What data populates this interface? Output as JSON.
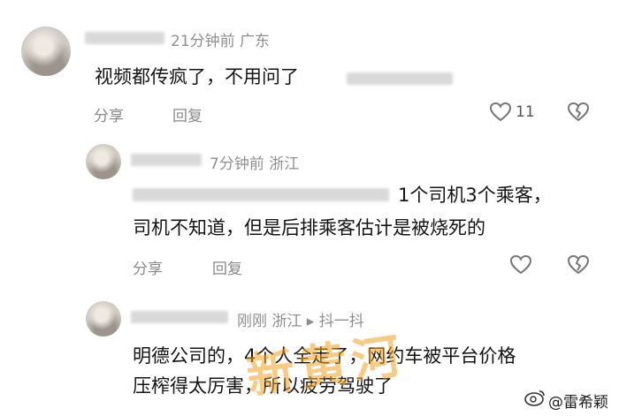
{
  "comments": [
    {
      "meta": "21分钟前 广东",
      "lines": [
        "视频都传疯了，不用问了"
      ],
      "reply": "分享",
      "comment": "回复",
      "likes": "11"
    },
    {
      "meta": "7分钟前 浙江",
      "lines": [
        "1个司机3个乘客，",
        "司机不知道，但是后排乘客估计是被烧死的"
      ],
      "reply": "分享",
      "comment": "回复"
    },
    {
      "meta": "刚刚 浙江 ▸ 抖一抖",
      "lines": [
        "明德公司的，4个人全走了，网约车被平台价格",
        "压榨得太厉害，所以疲劳驾驶了"
      ]
    }
  ],
  "watermark": {
    "text": "新黄河",
    "brand": "@雷希颖"
  },
  "colors": {
    "text": "#141414",
    "meta": "#8f8f8f",
    "action": "#8a8a8a",
    "watermark": "#f0a01e"
  },
  "icons": [
    "heart-outline-icon",
    "broken-heart-icon",
    "weibo-logo-icon"
  ]
}
